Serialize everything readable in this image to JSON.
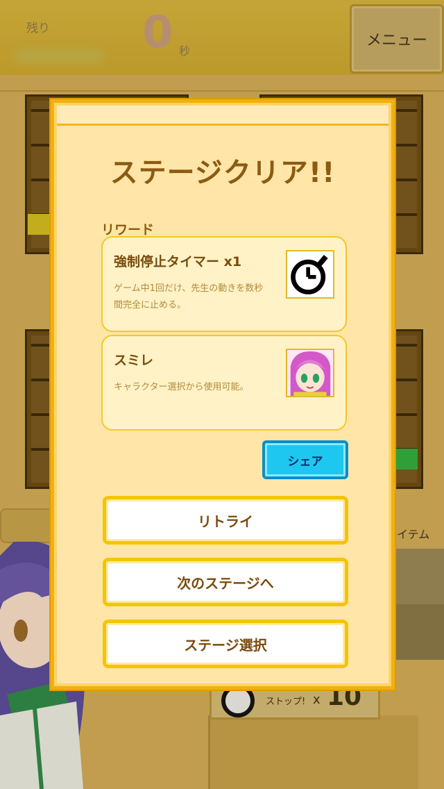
{
  "hud": {
    "remaining_label": "残り",
    "remaining_value": "0",
    "remaining_unit": "秒",
    "menu_label": "メニュー"
  },
  "background": {
    "item_label": "イテム",
    "stop_label": "ストップ!",
    "stop_multiplier": "x",
    "stop_count": "10"
  },
  "modal": {
    "title": "ステージクリア!!",
    "reward_section_label": "リワード",
    "rewards": [
      {
        "name": "強制停止タイマー x1",
        "description": "ゲーム中1回だけ、先生の動きを数秒間完全に止める。",
        "icon": "stopwatch-icon"
      },
      {
        "name": "スミレ",
        "description": "キャラクター選択から使用可能。",
        "icon": "character-portrait-sumire"
      }
    ],
    "share_label": "シェア",
    "retry_label": "リトライ",
    "next_stage_label": "次のステージへ",
    "stage_select_label": "ステージ選択"
  },
  "colors": {
    "modal_border": "#f0b010",
    "modal_bg": "#ffe6a8",
    "title_text": "#8c5a12",
    "share_button": "#1ec7f0",
    "button_border": "#f5c400"
  }
}
